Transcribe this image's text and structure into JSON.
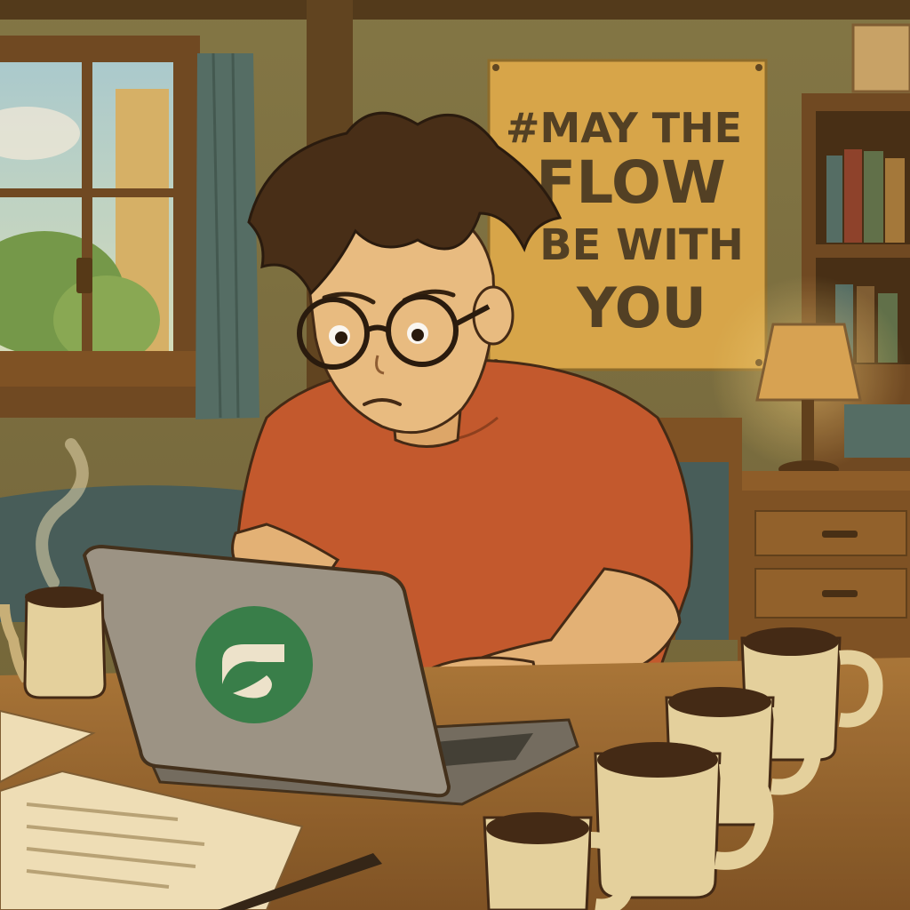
{
  "poster": {
    "line1": "#MAY THE",
    "line2": "FLOW",
    "line3": "BE WITH",
    "line4": "YOU"
  },
  "colors": {
    "wall": "#8a7a4a",
    "poster_bg": "#d9a84a",
    "shirt": "#c4552c",
    "laptop": "#9a948a",
    "logo_green": "#2e7d4a",
    "desk": "#9a6a34",
    "mug": "#e8d6a4",
    "coffee": "#3a2212"
  },
  "icons": {
    "laptop_logo": "flow-logo-icon"
  }
}
